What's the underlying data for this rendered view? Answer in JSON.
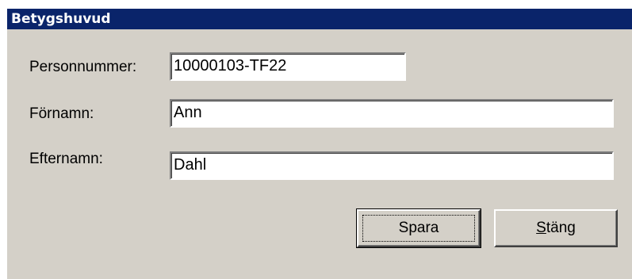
{
  "window": {
    "title": "Betygshuvud"
  },
  "form": {
    "personnummer": {
      "label": "Personnummer:",
      "value": "10000103-TF22"
    },
    "fornamn": {
      "label": "Förnamn:",
      "value": "Ann"
    },
    "efternamn": {
      "label": "Efternamn:",
      "value": "Dahl"
    }
  },
  "buttons": {
    "save": {
      "label": "Spara"
    },
    "close": {
      "label_accel": "S",
      "label_rest": "täng"
    }
  },
  "colors": {
    "titlebar": "#0a246a",
    "dialog_bg": "#d4d0c8"
  }
}
